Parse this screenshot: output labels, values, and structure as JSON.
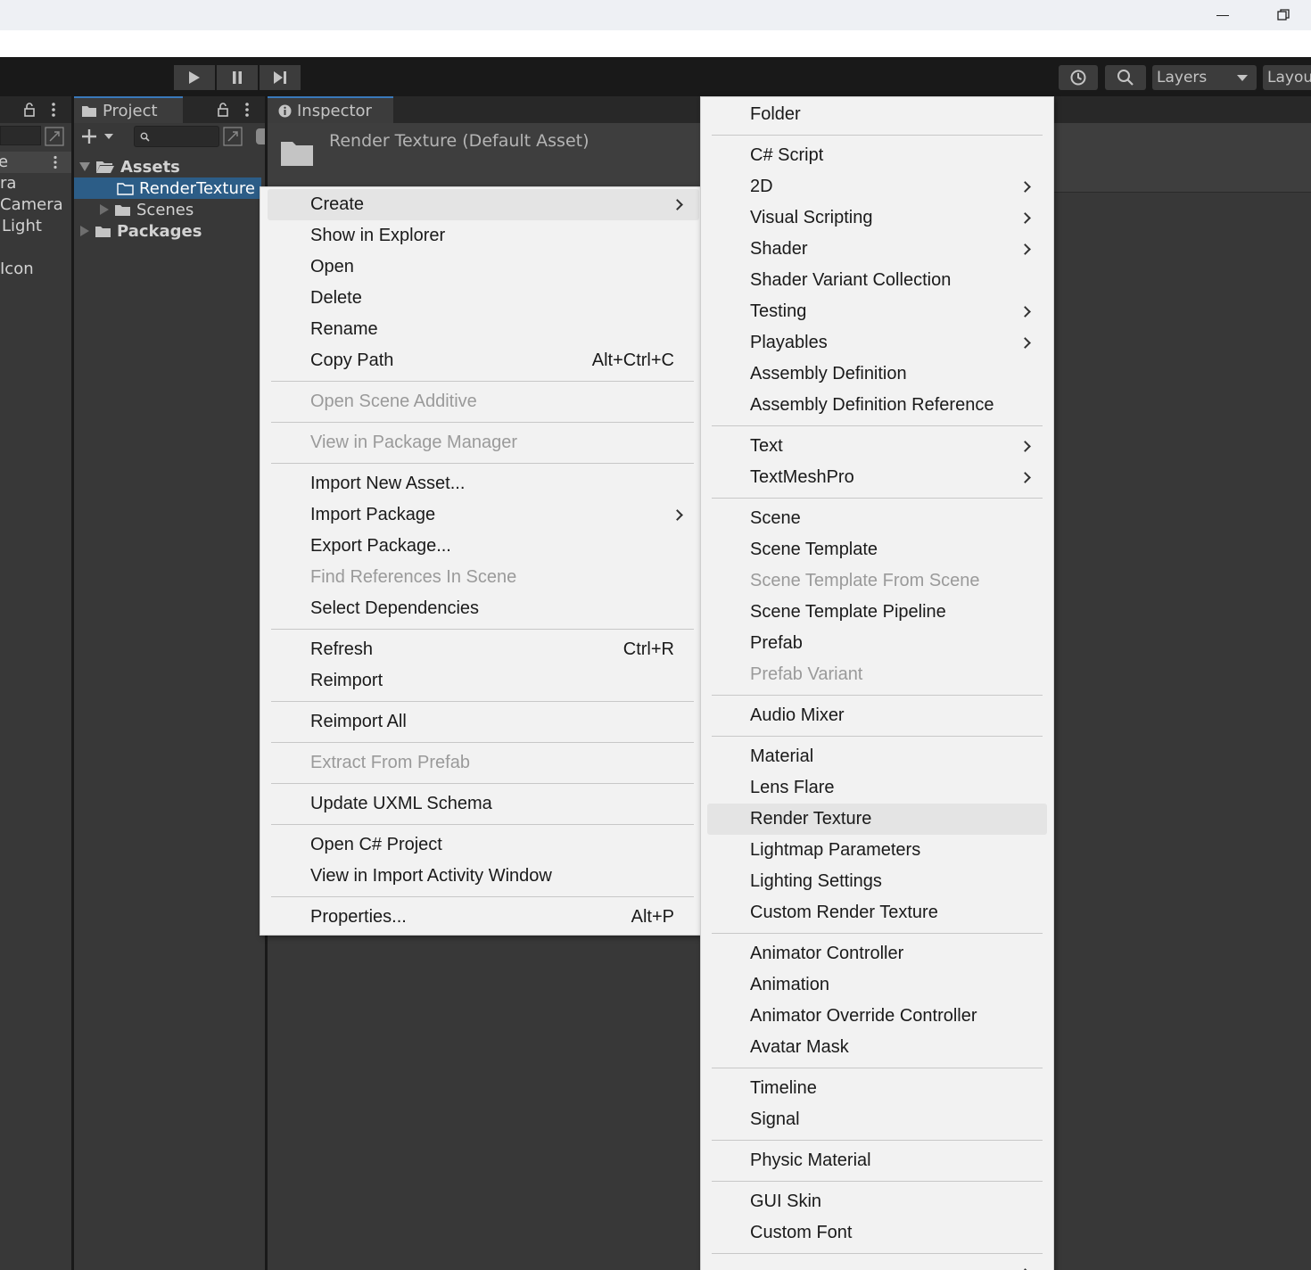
{
  "window": {
    "minimize_icon": "minimize-icon",
    "restore_icon": "restore-icon"
  },
  "toolbar": {
    "play_icon": "play-icon",
    "pause_icon": "pause-icon",
    "step_icon": "step-icon",
    "history_icon": "history-icon",
    "search_icon": "search-icon",
    "layers_label": "Layers",
    "layout_label": "Layou"
  },
  "hierarchy": {
    "header_text": "e",
    "items": [
      "ra",
      "Camera",
      "Light",
      "Icon"
    ]
  },
  "project": {
    "tab_label": "Project",
    "tree": {
      "assets": "Assets",
      "render_texture": "RenderTexture",
      "scenes": "Scenes",
      "packages": "Packages"
    }
  },
  "inspector": {
    "tab_label": "Inspector",
    "asset_title": "Render Texture (Default Asset)"
  },
  "context_menu": {
    "items": [
      {
        "label": "Create",
        "submenu": true,
        "highlighted": true
      },
      {
        "label": "Show in Explorer"
      },
      {
        "label": "Open"
      },
      {
        "label": "Delete"
      },
      {
        "label": "Rename"
      },
      {
        "label": "Copy Path",
        "shortcut": "Alt+Ctrl+C"
      },
      {
        "separator": true
      },
      {
        "label": "Open Scene Additive",
        "disabled": true
      },
      {
        "separator": true
      },
      {
        "label": "View in Package Manager",
        "disabled": true
      },
      {
        "separator": true
      },
      {
        "label": "Import New Asset..."
      },
      {
        "label": "Import Package",
        "submenu": true
      },
      {
        "label": "Export Package..."
      },
      {
        "label": "Find References In Scene",
        "disabled": true
      },
      {
        "label": "Select Dependencies"
      },
      {
        "separator": true
      },
      {
        "label": "Refresh",
        "shortcut": "Ctrl+R"
      },
      {
        "label": "Reimport"
      },
      {
        "separator": true
      },
      {
        "label": "Reimport All"
      },
      {
        "separator": true
      },
      {
        "label": "Extract From Prefab",
        "disabled": true
      },
      {
        "separator": true
      },
      {
        "label": "Update UXML Schema"
      },
      {
        "separator": true
      },
      {
        "label": "Open C# Project"
      },
      {
        "label": "View in Import Activity Window"
      },
      {
        "separator": true
      },
      {
        "label": "Properties...",
        "shortcut": "Alt+P"
      }
    ]
  },
  "create_submenu": {
    "items": [
      {
        "label": "Folder"
      },
      {
        "separator": true
      },
      {
        "label": "C# Script"
      },
      {
        "label": "2D",
        "submenu": true
      },
      {
        "label": "Visual Scripting",
        "submenu": true
      },
      {
        "label": "Shader",
        "submenu": true
      },
      {
        "label": "Shader Variant Collection"
      },
      {
        "label": "Testing",
        "submenu": true
      },
      {
        "label": "Playables",
        "submenu": true
      },
      {
        "label": "Assembly Definition"
      },
      {
        "label": "Assembly Definition Reference"
      },
      {
        "separator": true
      },
      {
        "label": "Text",
        "submenu": true
      },
      {
        "label": "TextMeshPro",
        "submenu": true
      },
      {
        "separator": true
      },
      {
        "label": "Scene"
      },
      {
        "label": "Scene Template"
      },
      {
        "label": "Scene Template From Scene",
        "disabled": true
      },
      {
        "label": "Scene Template Pipeline"
      },
      {
        "label": "Prefab"
      },
      {
        "label": "Prefab Variant",
        "disabled": true
      },
      {
        "separator": true
      },
      {
        "label": "Audio Mixer"
      },
      {
        "separator": true
      },
      {
        "label": "Material"
      },
      {
        "label": "Lens Flare"
      },
      {
        "label": "Render Texture",
        "highlighted": true
      },
      {
        "label": "Lightmap Parameters"
      },
      {
        "label": "Lighting Settings"
      },
      {
        "label": "Custom Render Texture"
      },
      {
        "separator": true
      },
      {
        "label": "Animator Controller"
      },
      {
        "label": "Animation"
      },
      {
        "label": "Animator Override Controller"
      },
      {
        "label": "Avatar Mask"
      },
      {
        "separator": true
      },
      {
        "label": "Timeline"
      },
      {
        "label": "Signal"
      },
      {
        "separator": true
      },
      {
        "label": "Physic Material"
      },
      {
        "separator": true
      },
      {
        "label": "GUI Skin"
      },
      {
        "label": "Custom Font"
      },
      {
        "separator": true
      },
      {
        "label": "",
        "submenu": true
      }
    ]
  }
}
